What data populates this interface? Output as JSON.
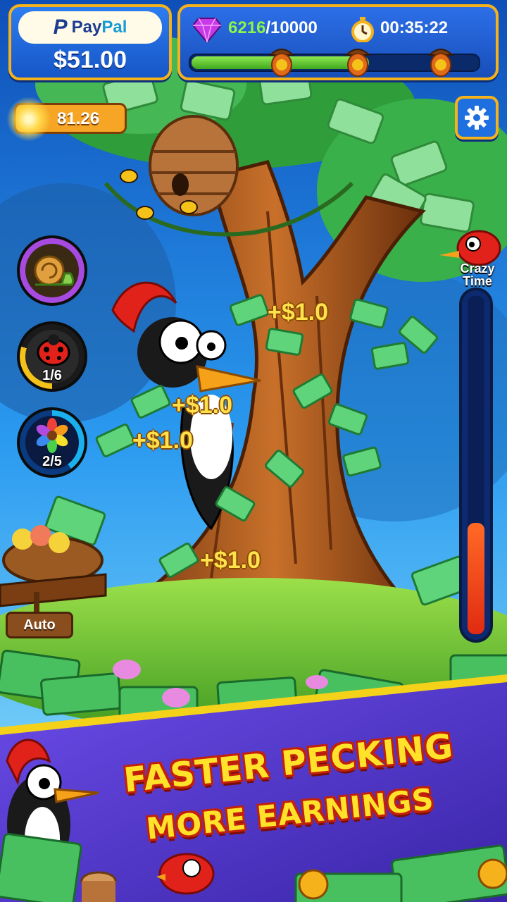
{
  "wallet": {
    "brand_mark": "P",
    "brand_name_pay": "Pay",
    "brand_name_pal": "Pal",
    "balance": "$51.00"
  },
  "progress": {
    "gems_current": "6216",
    "gems_total": "/10000",
    "timer": "00:35:22",
    "fill_fraction": 0.62,
    "milestone_icon": "acorn-dollar-icon"
  },
  "coins": {
    "value": "81.26"
  },
  "settings": {
    "icon": "gear-icon"
  },
  "boosters": [
    {
      "name": "snail",
      "count": ""
    },
    {
      "name": "ladybug",
      "count": "1/6"
    },
    {
      "name": "flower",
      "count": "2/5"
    }
  ],
  "crazy_time": {
    "label_line1": "Crazy",
    "label_line2": "Time",
    "fill_fraction": 0.33
  },
  "rewards": [
    "+$1.0",
    "+$1.0",
    "+$1.0",
    "+$1.0"
  ],
  "auto": {
    "label": "Auto"
  },
  "promo": {
    "line1": "FASTER PECKING",
    "line2": "MORE EARNINGS"
  },
  "colors": {
    "accent_gold": "#f5b21a",
    "card_blue": "#1e6fe0",
    "reward_yellow": "#ffe14d",
    "banner_purple": "#5a3fd6",
    "money_green": "#4cc86a"
  }
}
